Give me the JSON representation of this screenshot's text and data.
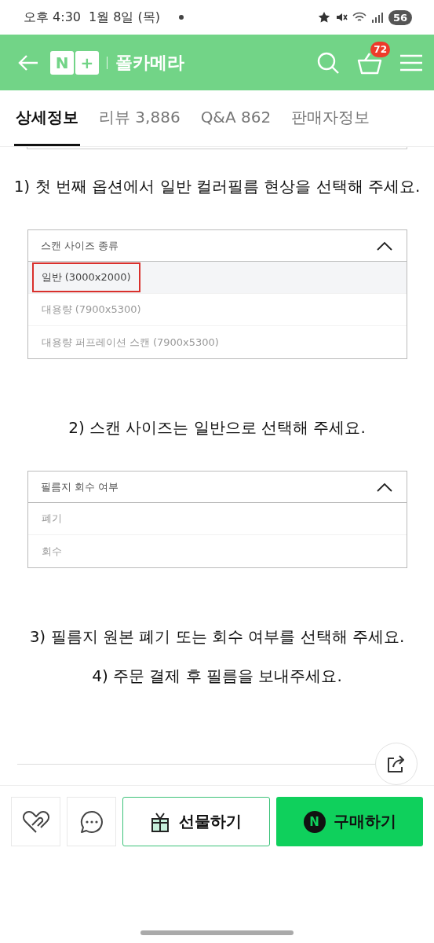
{
  "status_bar": {
    "time": "오후 4:30",
    "date": "1월 8일 (목)",
    "battery": "56"
  },
  "header": {
    "logo": {
      "letter": "N",
      "mark": "+"
    },
    "store_name": "폴카메라",
    "cart_count": "72"
  },
  "tabs": [
    {
      "label": "상세정보",
      "selected": true
    },
    {
      "label": "리뷰 3,886",
      "selected": false
    },
    {
      "label": "Q&A 862",
      "selected": false
    },
    {
      "label": "판매자정보",
      "selected": false
    }
  ],
  "content": [
    {
      "kind": "text",
      "text": "1) 첫 번째 옵션에서 일반 컬러필름 현상을 선택해 주세요."
    },
    {
      "kind": "dropdown",
      "title": "스캔 사이즈 종류",
      "expanded": true,
      "options": [
        {
          "label": "일반 (3000x2000)",
          "selected": true,
          "marked": true
        },
        {
          "label": "대용량 (7900x5300)",
          "selected": false,
          "marked": false
        },
        {
          "label": "대용량 퍼프레이션 스캔 (7900x5300)",
          "selected": false,
          "marked": false
        }
      ]
    },
    {
      "kind": "text",
      "text": "2) 스캔 사이즈는 일반으로 선택해 주세요."
    },
    {
      "kind": "dropdown",
      "title": "필름지 회수 여부",
      "expanded": true,
      "options": [
        {
          "label": "폐기",
          "selected": false,
          "marked": false
        },
        {
          "label": "회수",
          "selected": false,
          "marked": false
        }
      ]
    },
    {
      "kind": "text",
      "text": "3) 필름지 원본 폐기 또는 회수 여부를 선택해 주세요.\n4) 주문 결제 후 필름을 보내주세요."
    }
  ],
  "bottom_bar": {
    "gift_label": "선물하기",
    "buy_badge": "N",
    "buy_label": "구매하기"
  }
}
